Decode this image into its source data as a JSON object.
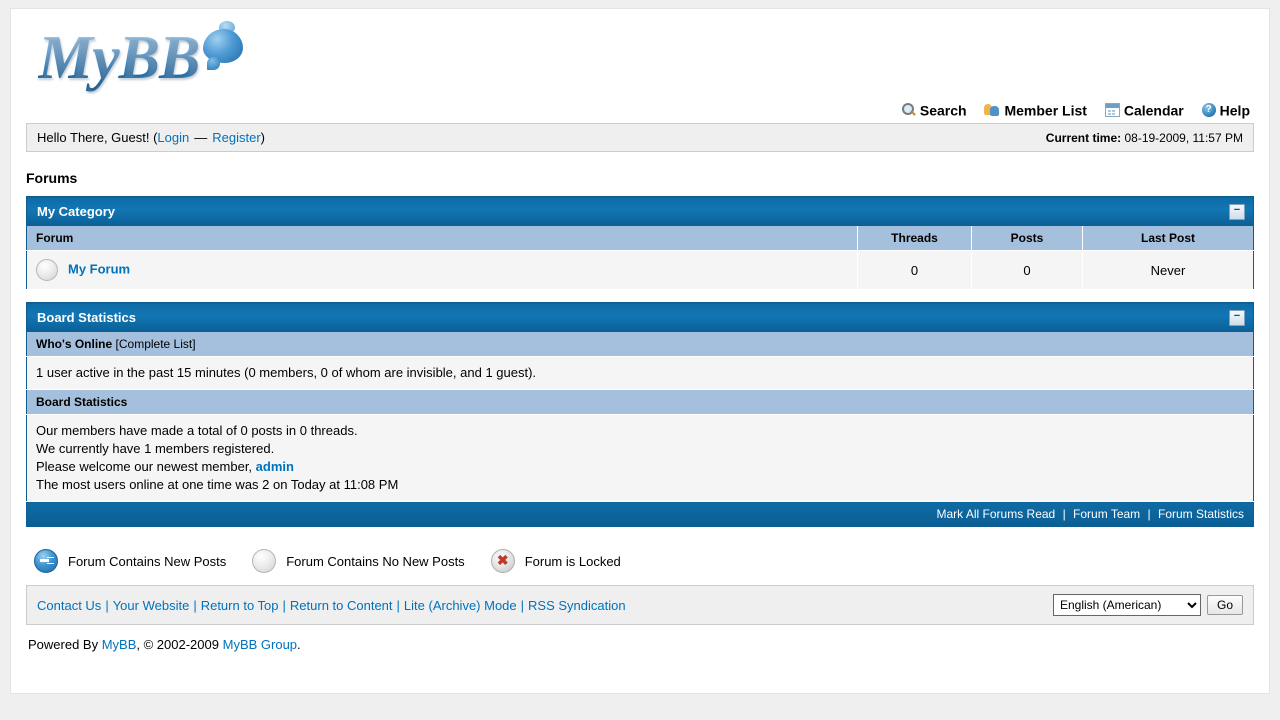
{
  "logo": {
    "text": "MyBB",
    "bubble_icon": "speech-bubble-icon"
  },
  "topmenu": [
    {
      "label": "Search",
      "icon": "search-icon"
    },
    {
      "label": "Member List",
      "icon": "members-icon"
    },
    {
      "label": "Calendar",
      "icon": "calendar-icon"
    },
    {
      "label": "Help",
      "icon": "help-icon",
      "glyph": "?"
    }
  ],
  "welcome": {
    "greeting": "Hello There, Guest! (",
    "login": "Login",
    "dash": "—",
    "register": "Register",
    "close_paren": ")",
    "time_label": "Current time:",
    "time_value": "08-19-2009, 11:57 PM"
  },
  "page_title": "Forums",
  "category": {
    "title": "My Category",
    "collapse_glyph": "−",
    "columns": {
      "forum": "Forum",
      "threads": "Threads",
      "posts": "Posts",
      "lastpost": "Last Post"
    },
    "rows": [
      {
        "icon": "forum-no-new-posts-icon",
        "name": "My Forum",
        "threads": "0",
        "posts": "0",
        "lastpost": "Never"
      }
    ]
  },
  "board_stats": {
    "title": "Board Statistics",
    "collapse_glyph": "−",
    "whos_online_label": "Who's Online",
    "complete_list": "[Complete List]",
    "online_text": "1 user active in the past 15 minutes (0 members, 0 of whom are invisible, and 1 guest).",
    "stats_subhead": "Board Statistics",
    "line1": "Our members have made a total of 0 posts in 0 threads.",
    "line2": "We currently have 1 members registered.",
    "line3_prefix": "Please welcome our newest member,",
    "newest_member": "admin",
    "line4": "The most users online at one time was 2 on Today at 11:08 PM",
    "footer_links": [
      "Mark All Forums Read",
      "Forum Team",
      "Forum Statistics"
    ]
  },
  "legend": [
    {
      "icon": "forum-new-posts-icon",
      "label": "Forum Contains New Posts"
    },
    {
      "icon": "forum-no-new-posts-icon",
      "label": "Forum Contains No New Posts"
    },
    {
      "icon": "forum-locked-icon",
      "label": "Forum is Locked",
      "glyph": "✖"
    }
  ],
  "footer": {
    "links": [
      "Contact Us",
      "Your Website",
      "Return to Top",
      "Return to Content",
      "Lite (Archive) Mode",
      "RSS Syndication"
    ],
    "language_selected": "English (American)",
    "go_label": "Go"
  },
  "powered": {
    "prefix": "Powered By",
    "mybb": "MyBB",
    "middle": ", © 2002-2009",
    "group": "MyBB Group",
    "suffix": "."
  },
  "colors": {
    "accent": "#0072BC",
    "header_blue": "#0f6ba5",
    "col_head": "#A5C0DD",
    "page_bg": "#efefef"
  }
}
